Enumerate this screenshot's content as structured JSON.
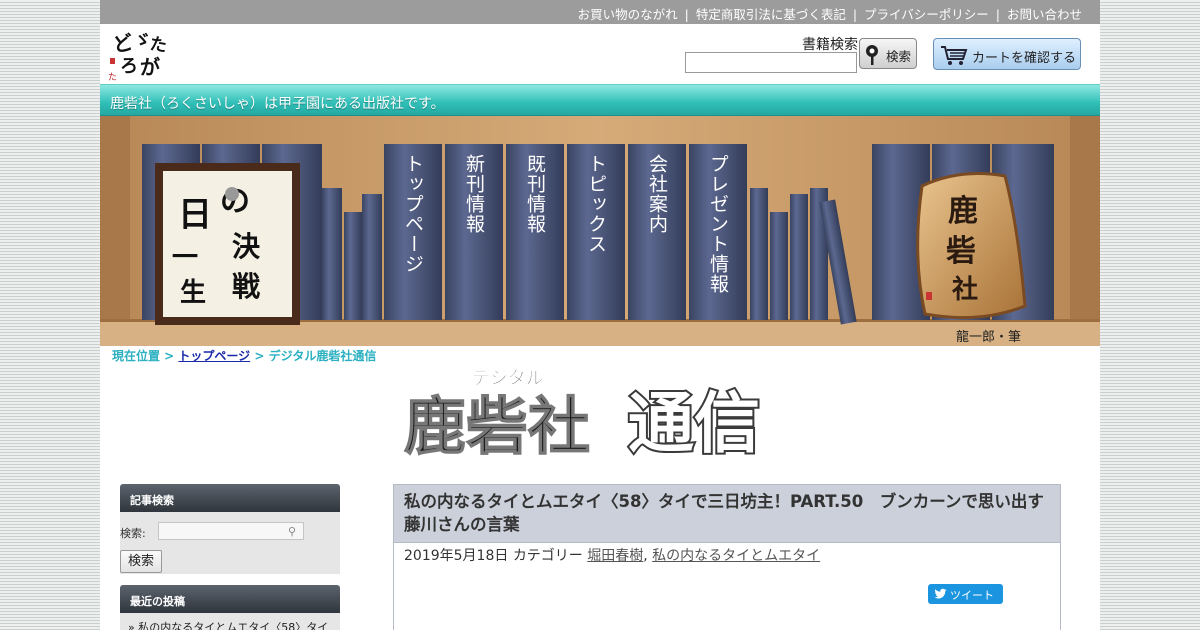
{
  "topbar": {
    "links": [
      "お買い物のながれ",
      "特定商取引法に基づく表記",
      "プライバシーポリシー",
      "お問い合わせ"
    ],
    "separator": "|"
  },
  "header": {
    "logo_text": "ろくさいしゃ",
    "search_label": "書籍検索",
    "search_button": "検索",
    "cart_button": "カートを確認する"
  },
  "tagline": "鹿砦社（ろくさいしゃ）は甲子園にある出版社です。",
  "shelf": {
    "nav": [
      "トップページ",
      "新刊情報",
      "既刊情報",
      "トピックス",
      "会社案内",
      "プレゼント情報"
    ],
    "calligraphy_frame_text": "一日一生 の決戦",
    "wood_sign_text": "鹿砦社",
    "credit": "龍一郎・筆"
  },
  "breadcrumb": {
    "prefix": "現在位置 >",
    "link": "トップページ",
    "arrow": ">",
    "current": "デジタル鹿砦社通信"
  },
  "title_logo": {
    "small": "デジタル",
    "main": "鹿砦社",
    "big": "通信"
  },
  "sidebar": {
    "search_widget_title": "記事検索",
    "search_label": "検索:",
    "search_button": "検索",
    "recent_widget_title": "最近の投稿",
    "recent_items": [
      "» 私の内なるタイとムエタイ〈58〉タイ"
    ]
  },
  "article": {
    "title": "私の内なるタイとムエタイ〈58〉タイで三日坊主！PART.50　ブンカーンで思い出す藤川さんの言葉",
    "date": "2019年5月18日",
    "category_label": "カテゴリー",
    "categories": [
      "堀田春樹",
      "私の内なるタイとムエタイ"
    ],
    "tweet_button": "ツイート"
  },
  "colors": {
    "topbar": "#9c9c9c",
    "tagline": "#2fbfb7",
    "article_header": "#cbd0da",
    "breadcrumb": "#2ab0c0",
    "tweet": "#1b95e0",
    "book_spine": "#4f5a7a"
  }
}
